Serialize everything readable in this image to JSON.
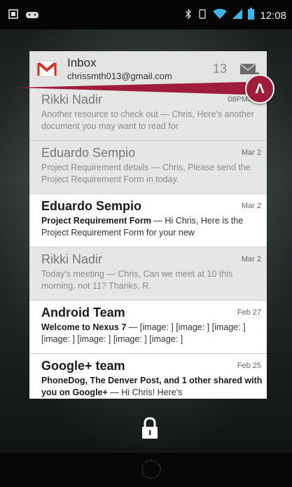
{
  "status_bar": {
    "time": "12:08",
    "left_icons": [
      "notification-icon",
      "gamepad-icon"
    ],
    "right_icons": [
      "bluetooth-icon",
      "rotate-icon",
      "wifi-icon",
      "signal-icon",
      "battery-icon"
    ]
  },
  "widget": {
    "title": "Inbox",
    "account": "chrissmth013@gmail.com",
    "unread_count": "13",
    "messages": [
      {
        "sender": "Rikki Nadir",
        "date": "08PMar 2",
        "subject": "Another resource to check out",
        "preview": " — Chris, Here's another document you may want to read for",
        "unread": false
      },
      {
        "sender": "Eduardo Sempio",
        "date": "Mar 2",
        "subject": "Project Requirement details",
        "preview": " — Chris, Please send the Project Requirement Form in today.",
        "unread": false
      },
      {
        "sender": "Eduardo Sempio",
        "date": "Mar 2",
        "subject": "Project Requirement Form",
        "preview": " — Hi Chris, Here is the  Project Requirement Form for your new",
        "unread": true
      },
      {
        "sender": "Rikki Nadir",
        "date": "Mar 2",
        "subject": "Today's meeting",
        "preview": " — Chris, Can we meet at 10 this morning, not 11? Thanks, R.",
        "unread": false
      },
      {
        "sender": "Android Team",
        "date": "Feb 27",
        "subject": "Welcome to Nexus 7",
        "preview": " — [image: ] [image: ] [image: ] [image: ] [image: ] [image: ] [image: ]",
        "unread": true
      },
      {
        "sender": "Google+ team",
        "date": "Feb 25",
        "subject": "PhoneDog, The Denver Post, and 1 other shared with you on Google+",
        "preview": " — Hi Chris! Here's",
        "unread": true
      }
    ]
  },
  "annotation": {
    "label": "Λ"
  },
  "colors": {
    "annotation": "#a01d3a",
    "gmail_red": "#d93025"
  }
}
